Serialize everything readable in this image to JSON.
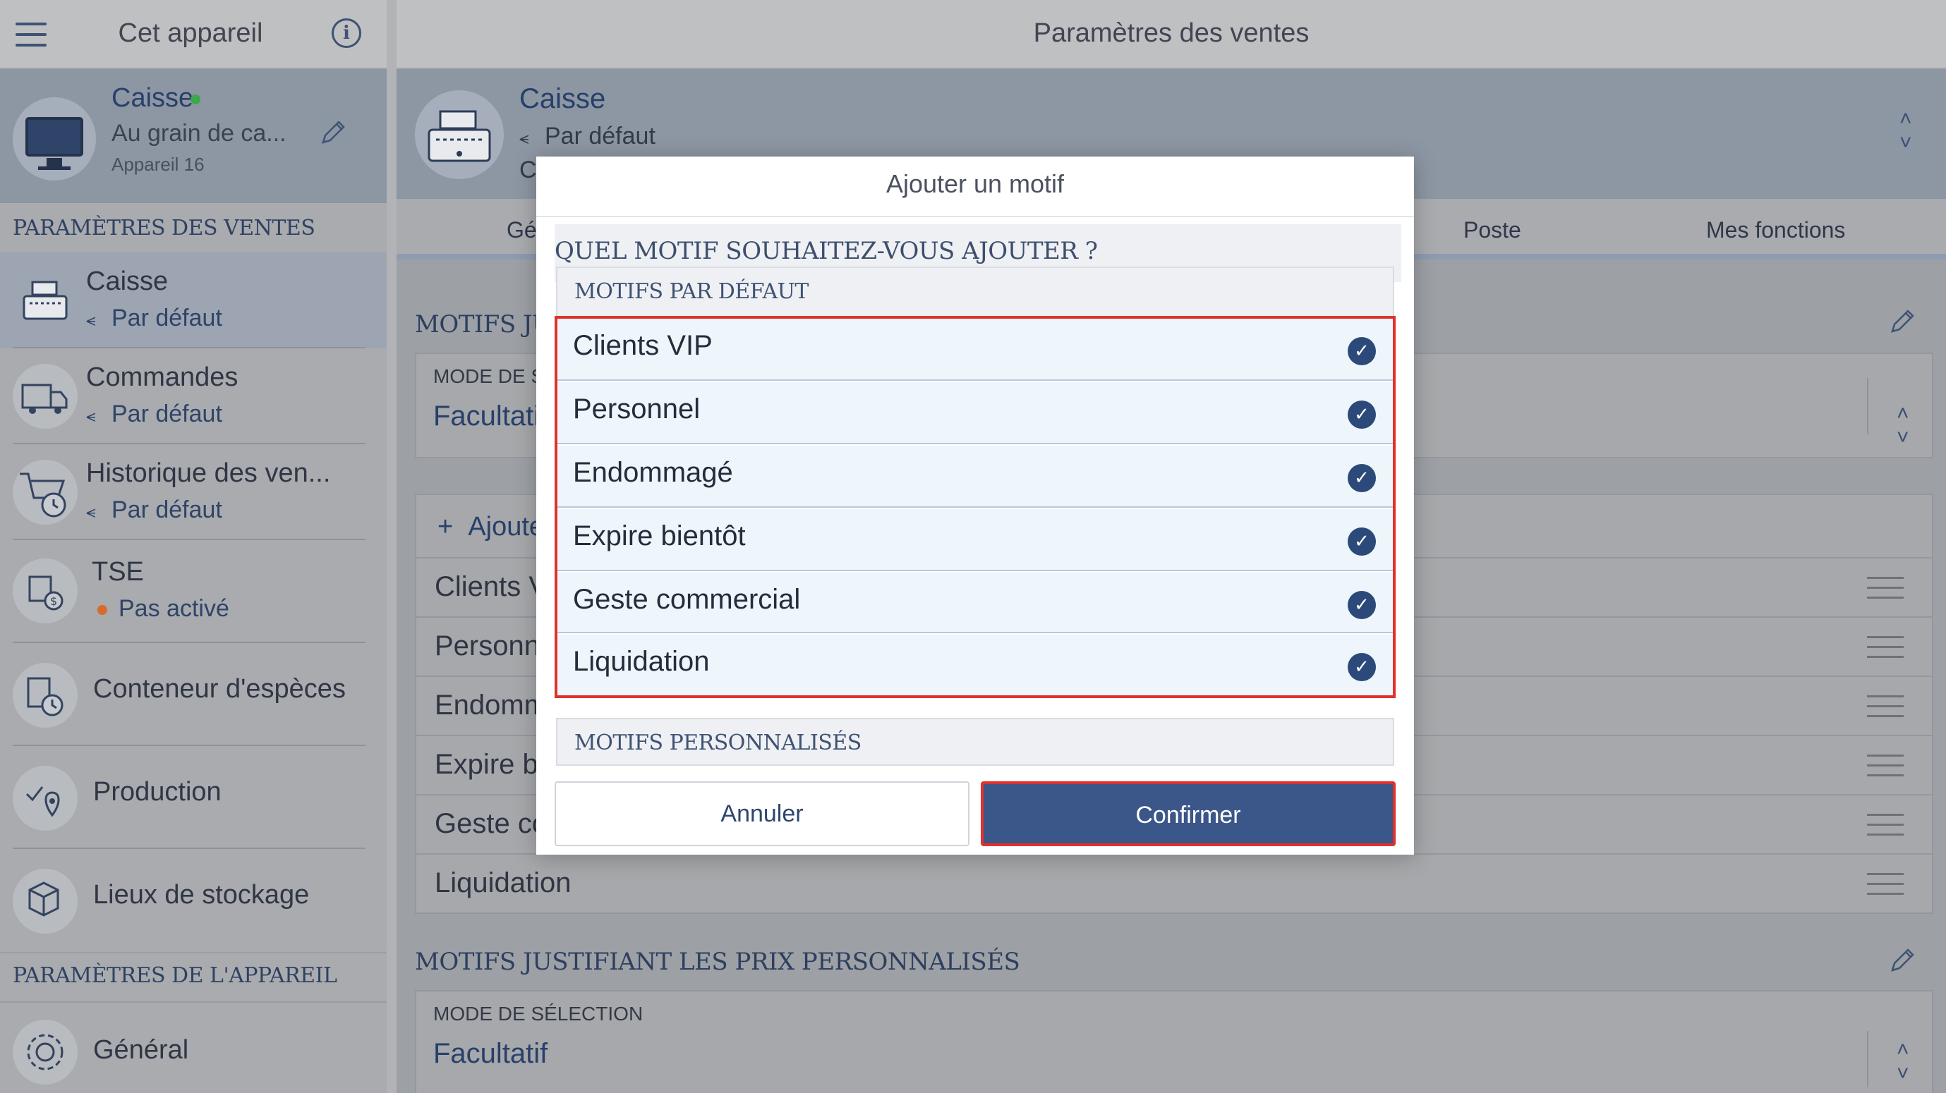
{
  "sidebar": {
    "header_title": "Cet appareil",
    "device": {
      "name": "Caisse",
      "location": "Au grain de ca...",
      "meta": "Appareil 16"
    },
    "section_sales": "PARAMÈTRES DES VENTES",
    "items": [
      {
        "label": "Caisse",
        "sub": "Par défaut"
      },
      {
        "label": "Commandes",
        "sub": "Par défaut"
      },
      {
        "label": "Historique des ven...",
        "sub": "Par défaut"
      },
      {
        "label": "TSE",
        "sub": "Pas activé"
      },
      {
        "label": "Conteneur d'espèces"
      },
      {
        "label": "Production"
      },
      {
        "label": "Lieux de stockage"
      }
    ],
    "section_device": "PARAMÈTRES DE L'APPAREIL",
    "general": "Général"
  },
  "main": {
    "header_title": "Paramètres des ventes",
    "card": {
      "title": "Caisse",
      "sub": "Par défaut",
      "clipped": "Co"
    },
    "tabs": [
      "Gé",
      "Poste",
      "Mes fonctions"
    ],
    "section1": {
      "title": "MOTIFS JU",
      "mode_label": "MODE DE SÉ",
      "mode_value": "Facultati",
      "add_label": "Ajoute",
      "rows": [
        "Clients V",
        "Personn",
        "Endomm",
        "Expire b",
        "Geste co",
        "Liquidation"
      ]
    },
    "section2": {
      "title": "MOTIFS JUSTIFIANT LES PRIX PERSONNALISÉS",
      "mode_label": "MODE DE SÉLECTION",
      "mode_value": "Facultatif"
    }
  },
  "modal": {
    "title": "Ajouter un motif",
    "question": "QUEL MOTIF SOUHAITEZ-VOUS AJOUTER ?",
    "group_default": "MOTIFS PAR DÉFAUT",
    "options": [
      "Clients VIP",
      "Personnel",
      "Endommagé",
      "Expire bientôt",
      "Geste commercial",
      "Liquidation"
    ],
    "group_custom": "MOTIFS PERSONNALISÉS",
    "cancel": "Annuler",
    "confirm": "Confirmer"
  },
  "colors": {
    "accent": "#3b5688",
    "highlight": "#e0312b",
    "status_on": "#3ea84a",
    "status_off": "#d96a2b"
  }
}
